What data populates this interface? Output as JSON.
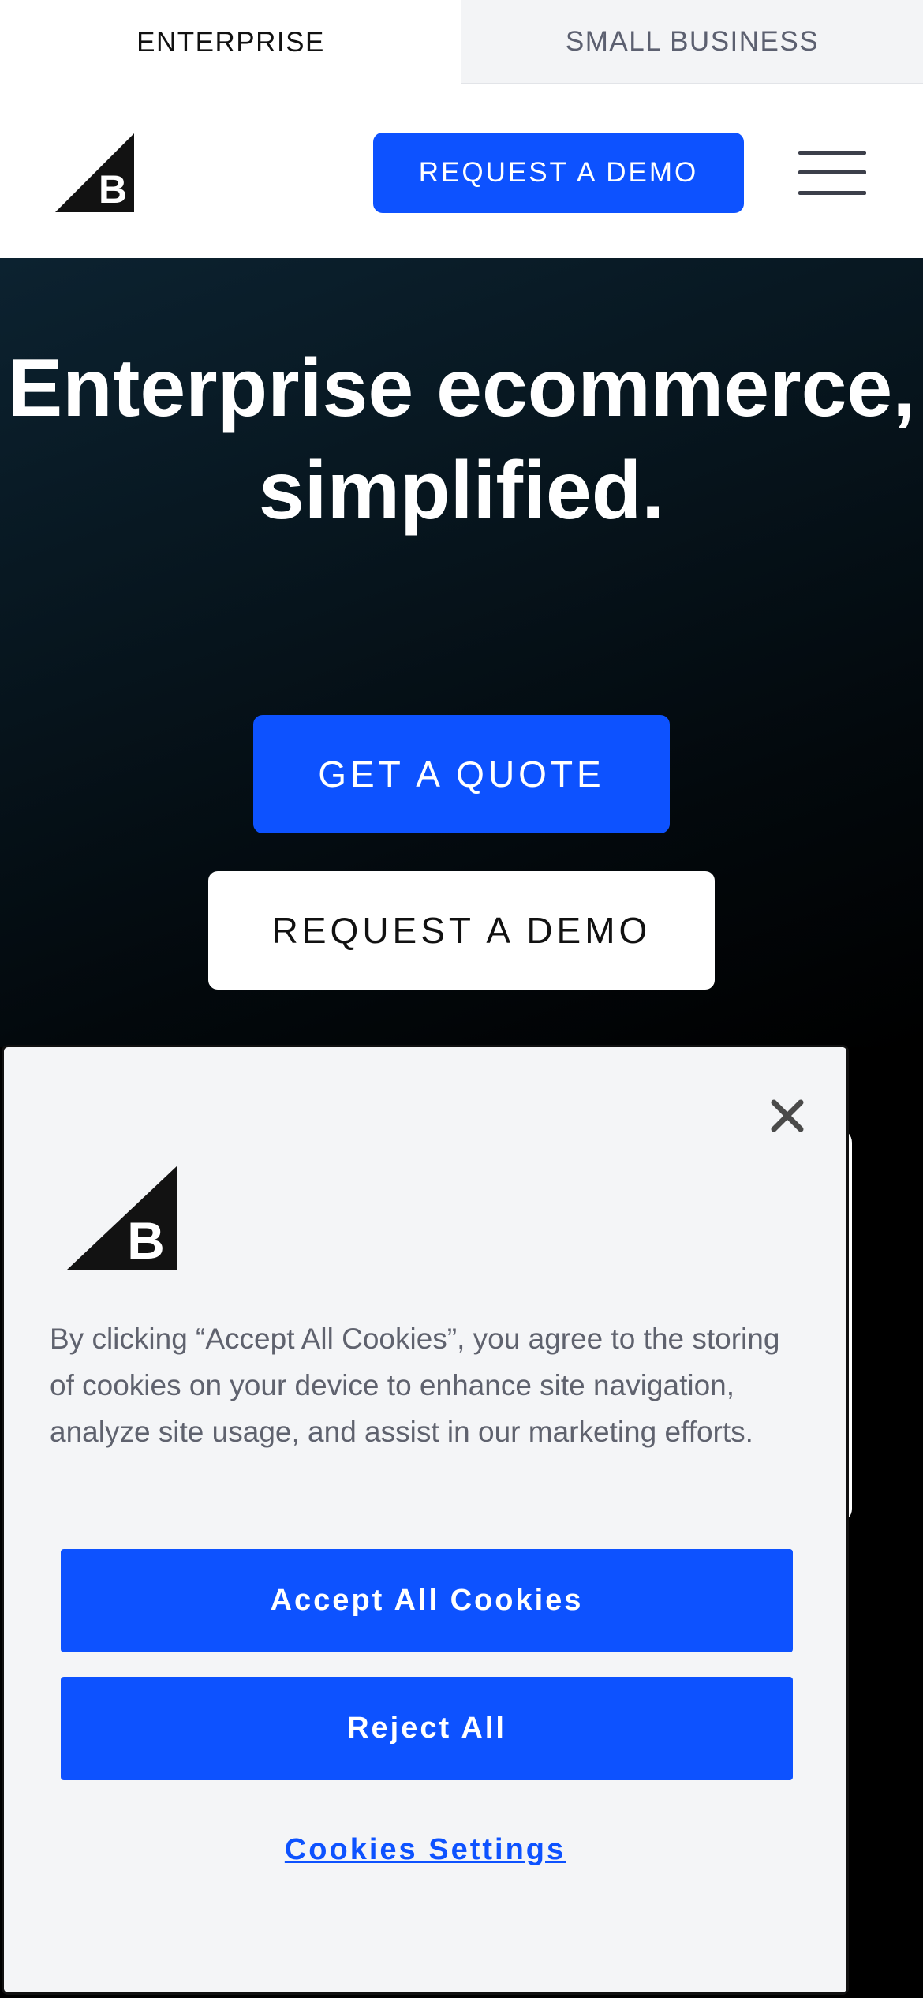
{
  "tabs": {
    "enterprise": "ENTERPRISE",
    "small_business": "SMALL BUSINESS"
  },
  "header": {
    "logo_icon": "bigcommerce-logo-icon",
    "demo_label": "REQUEST A DEMO",
    "menu_icon": "hamburger-menu-icon"
  },
  "hero": {
    "title": "Enterprise ecommerce, simplified.",
    "quote_label": "GET A QUOTE",
    "demo_label": "REQUEST A DEMO"
  },
  "cookie_banner": {
    "close_icon": "close-icon",
    "logo_icon": "bigcommerce-logo-icon",
    "text": "By clicking “Accept All Cookies”, you agree to the storing of cookies on your device to enhance site navigation, analyze site usage, and assist in our marketing efforts.",
    "accept_label": "Accept All Cookies",
    "reject_label": "Reject All",
    "settings_label": "Cookies Settings"
  },
  "colors": {
    "accent_blue": "#0d52ff",
    "hero_dark": "#07161f",
    "banner_bg": "#f4f5f7"
  }
}
